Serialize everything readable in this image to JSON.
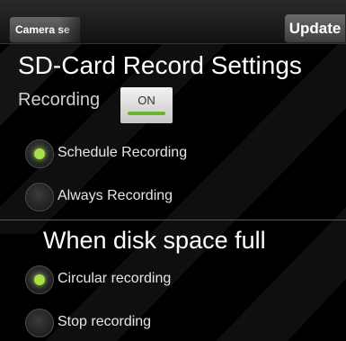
{
  "header": {
    "back_label": "Camera se",
    "update_label": "Update"
  },
  "page_title": "SD-Card Record Settings",
  "recording": {
    "label": "Recording",
    "toggle_text": "ON",
    "toggle_on": true
  },
  "record_mode": {
    "options": [
      {
        "label": "Schedule Recording",
        "checked": true
      },
      {
        "label": "Always Recording",
        "checked": false
      }
    ]
  },
  "disk_full": {
    "title": "When disk space full",
    "options": [
      {
        "label": "Circular recording",
        "checked": true
      },
      {
        "label": "Stop recording",
        "checked": false
      }
    ]
  },
  "colors": {
    "accent_green": "#a8e04a",
    "background": "#000000"
  }
}
